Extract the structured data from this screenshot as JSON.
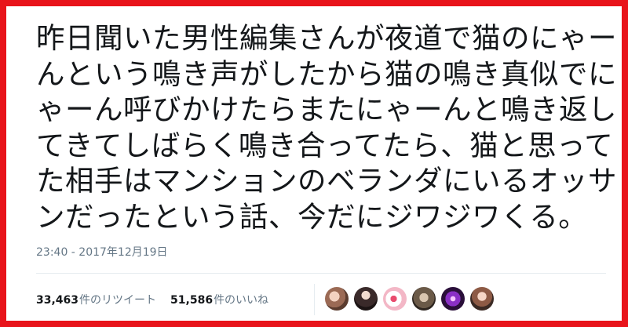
{
  "tweet": {
    "lines": [
      "昨日聞いた男性編集さんが夜道で猫のにゃー",
      "んという鳴き声がしたから猫の鳴き真似でに",
      "ゃーん呼びかけたらまたにゃーんと鳴き返し",
      "てきてしばらく鳴き合ってたら、猫と思って",
      "た相手はマンションのベランダにいるオッサ",
      "ンだったという話、今だにジワジワくる。"
    ],
    "timestamp": "23:40 - 2017年12月19日"
  },
  "stats": {
    "retweets_count": "33,463",
    "retweets_label": "件のリツイート",
    "likes_count": "51,586",
    "likes_label": "件のいいね"
  },
  "avatars": [
    {
      "name": "avatar-1"
    },
    {
      "name": "avatar-2"
    },
    {
      "name": "avatar-3"
    },
    {
      "name": "avatar-4"
    },
    {
      "name": "avatar-5"
    },
    {
      "name": "avatar-6"
    }
  ],
  "colors": {
    "frame_border": "#e8141b",
    "text": "#14171a",
    "muted": "#657786",
    "divider": "#e6ecf0"
  }
}
